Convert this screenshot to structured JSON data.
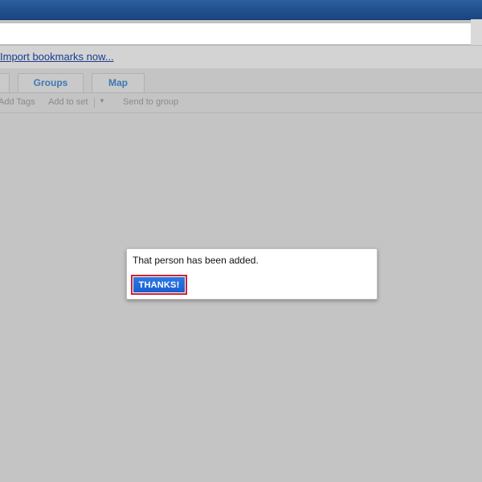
{
  "import_bar": {
    "link_text": "Import bookmarks now..."
  },
  "tabs": [
    {
      "label": ""
    },
    {
      "label": "Groups"
    },
    {
      "label": "Map"
    }
  ],
  "toolbar": {
    "add_tags_label": "Add Tags",
    "add_to_set_label": "Add to set",
    "dropdown_glyph": "▼",
    "send_to_group_label": "Send to group"
  },
  "dialog": {
    "message": "That person has been added.",
    "button_label": "THANKS!"
  },
  "colors": {
    "titlebar": "#1f4f8c",
    "overlay_gray": "#c4c4c4",
    "tab_text_blue": "#3e78b4",
    "link_blue": "#1a3c8c",
    "button_blue": "#1a5fd0",
    "highlight_red": "#d4212d"
  }
}
